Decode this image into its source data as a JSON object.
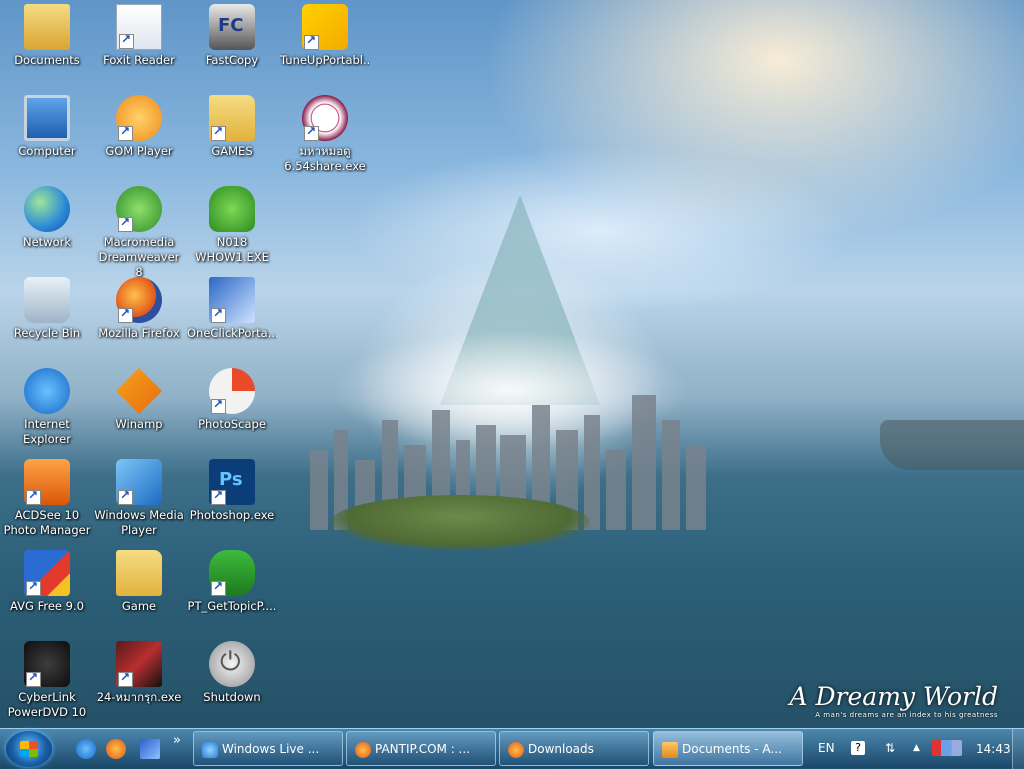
{
  "desktop": {
    "icons": [
      {
        "label": "Documents",
        "icon": "documents-folder-icon"
      },
      {
        "label": "Computer",
        "icon": "computer-icon"
      },
      {
        "label": "Network",
        "icon": "network-icon"
      },
      {
        "label": "Recycle Bin",
        "icon": "recycle-bin-icon"
      },
      {
        "label": "Internet Explorer",
        "icon": "internet-explorer-icon"
      },
      {
        "label": "ACDSee 10 Photo Manager",
        "icon": "acdsee-icon"
      },
      {
        "label": "AVG Free 9.0",
        "icon": "avg-icon"
      },
      {
        "label": "CyberLink PowerDVD 10",
        "icon": "powerdvd-icon"
      },
      {
        "label": "Foxit Reader",
        "icon": "foxit-reader-icon"
      },
      {
        "label": "GOM Player",
        "icon": "gom-player-icon"
      },
      {
        "label": "Macromedia Dreamweaver 8",
        "icon": "dreamweaver-icon"
      },
      {
        "label": "Mozilla Firefox",
        "icon": "firefox-icon"
      },
      {
        "label": "Winamp",
        "icon": "winamp-icon"
      },
      {
        "label": "Windows Media Player",
        "icon": "windows-media-player-icon"
      },
      {
        "label": "Game",
        "icon": "folder-icon"
      },
      {
        "label": "24-หมากรุก.exe",
        "icon": "chess-icon"
      },
      {
        "label": "FastCopy",
        "icon": "fastcopy-icon"
      },
      {
        "label": "GAMES",
        "icon": "folder-icon"
      },
      {
        "label": "N018 WHOW1.EXE",
        "icon": "dragon-icon"
      },
      {
        "label": "OneClickPorta...",
        "icon": "oneclick-icon"
      },
      {
        "label": "PhotoScape",
        "icon": "photoscape-icon"
      },
      {
        "label": "Photoshop.exe",
        "icon": "photoshop-icon"
      },
      {
        "label": "PT_GetTopicP....",
        "icon": "cactus-icon"
      },
      {
        "label": "Shutdown",
        "icon": "power-icon"
      },
      {
        "label": "TuneUpPortabl...",
        "icon": "tuneup-icon"
      },
      {
        "label": "มหาหมอดู 6.54share.exe",
        "icon": "fortune-icon"
      }
    ]
  },
  "wallpaper": {
    "title": "A Dreamy World",
    "tagline": "A man's dreams are an index to his greatness"
  },
  "taskbar": {
    "tasks": [
      {
        "label": "Windows Live ...",
        "icon": "windows-live-icon"
      },
      {
        "label": "PANTIP.COM : ...",
        "icon": "firefox-icon"
      },
      {
        "label": "Downloads",
        "icon": "firefox-icon"
      },
      {
        "label": "Documents - A...",
        "icon": "folder-icon"
      }
    ],
    "more": "»",
    "tray": {
      "language": "EN",
      "help": "?",
      "clock": "14:43"
    }
  }
}
